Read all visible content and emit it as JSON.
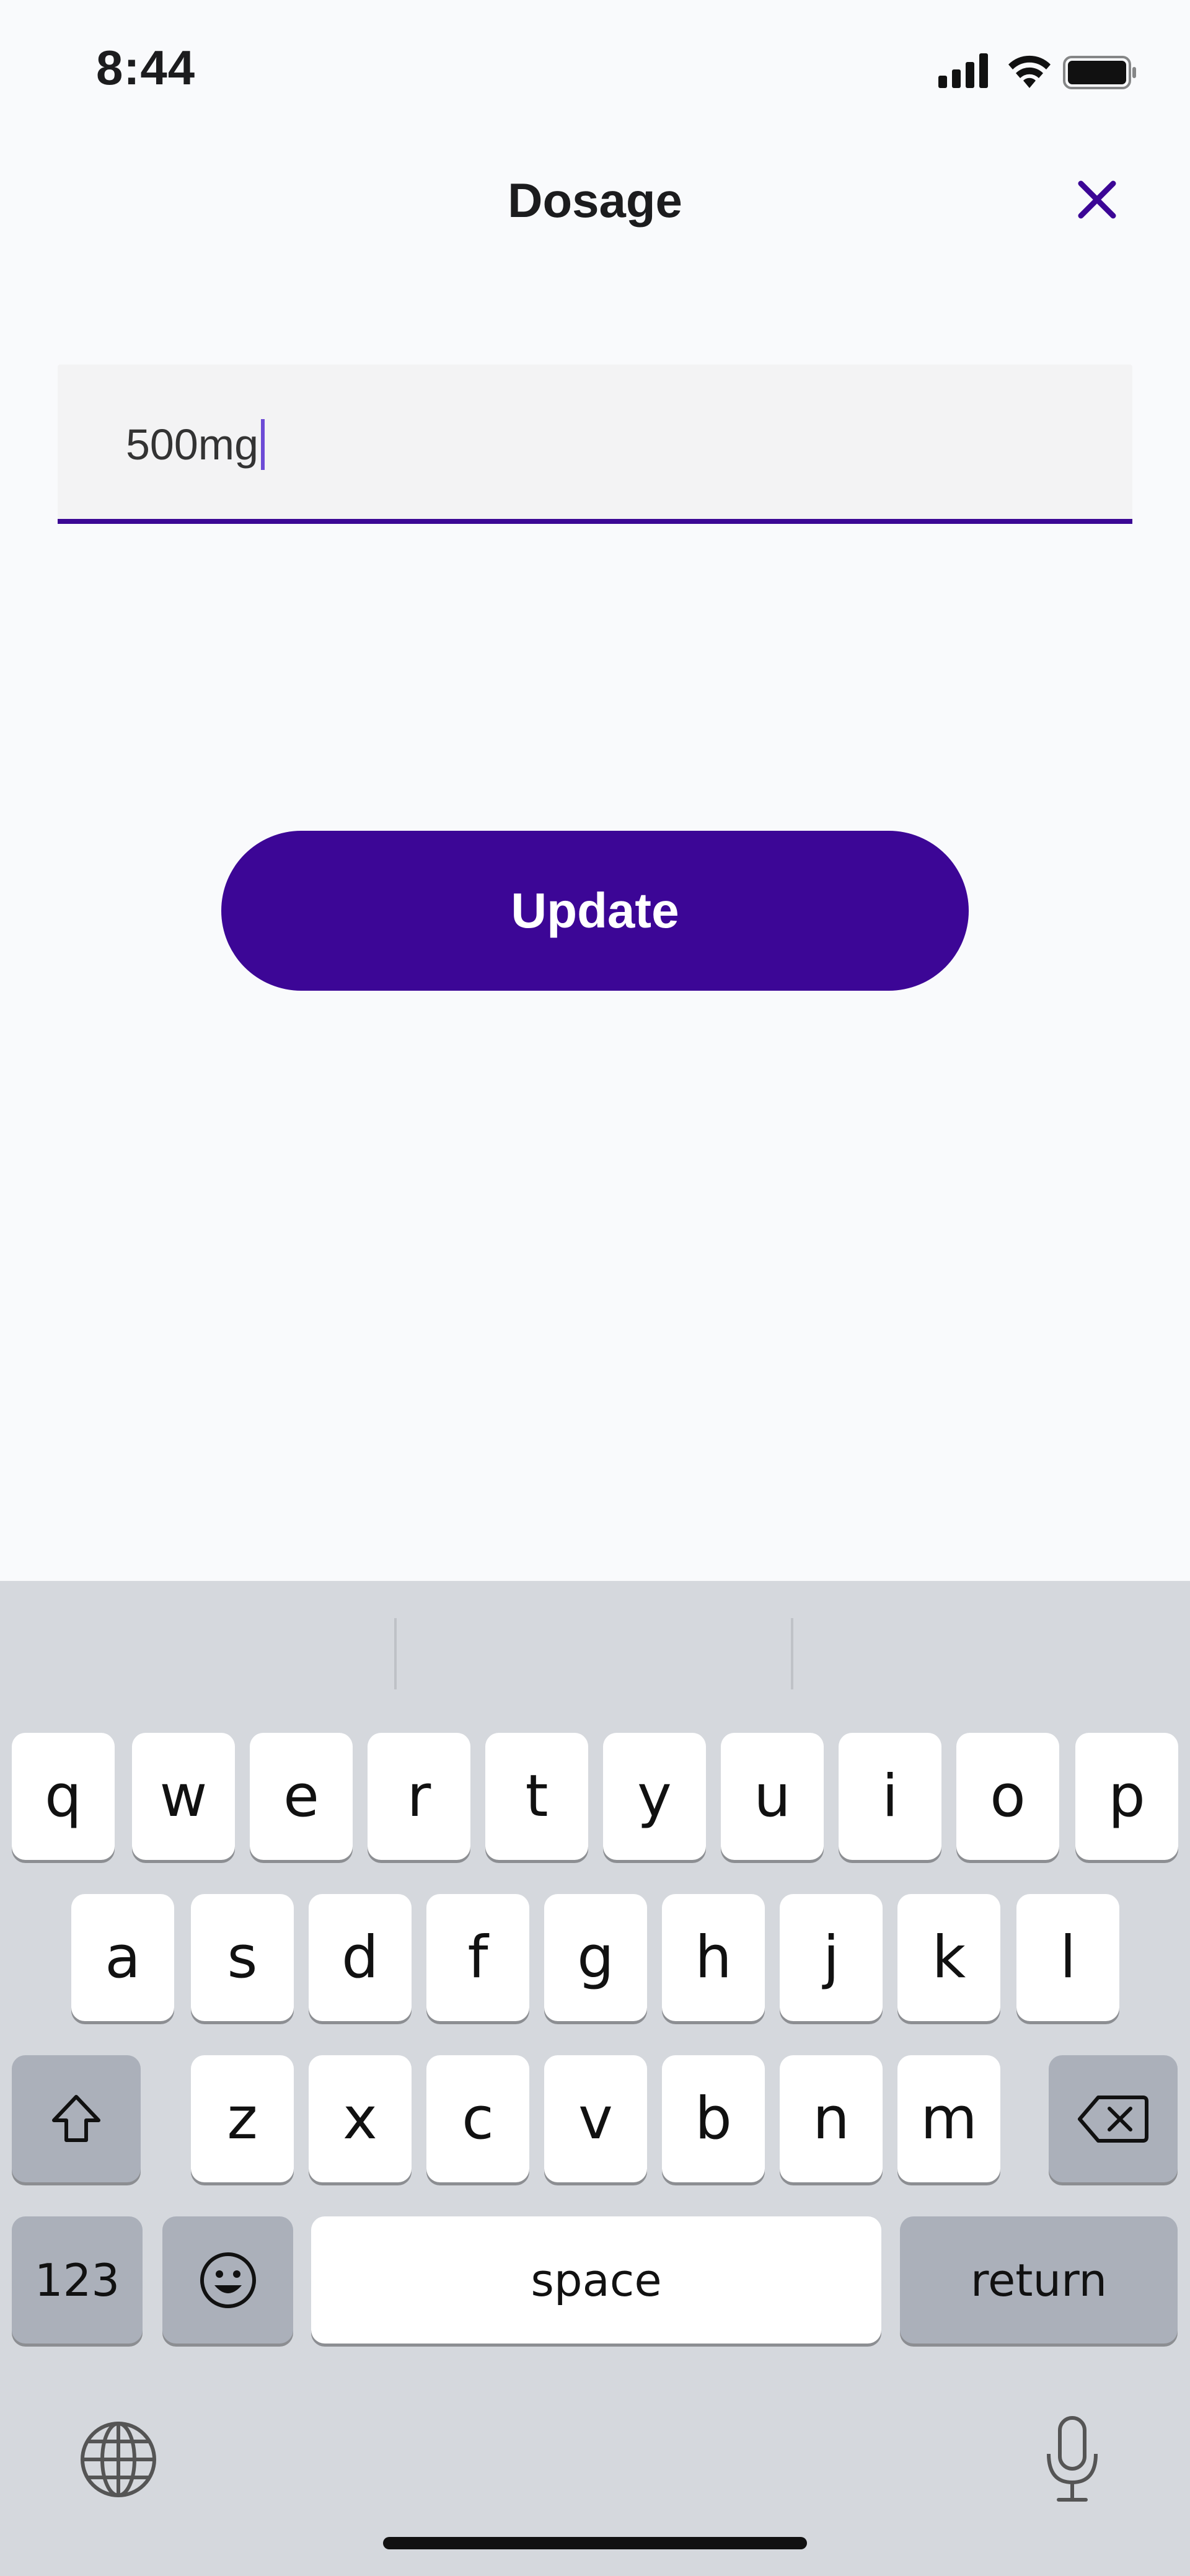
{
  "status_bar": {
    "time": "8:44"
  },
  "header": {
    "title": "Dosage"
  },
  "dosage_input": {
    "value": "500mg"
  },
  "actions": {
    "update_label": "Update"
  },
  "keyboard": {
    "row1": [
      "q",
      "w",
      "e",
      "r",
      "t",
      "y",
      "u",
      "i",
      "o",
      "p"
    ],
    "row2": [
      "a",
      "s",
      "d",
      "f",
      "g",
      "h",
      "j",
      "k",
      "l"
    ],
    "row3": [
      "z",
      "x",
      "c",
      "v",
      "b",
      "n",
      "m"
    ],
    "numbers_label": "123",
    "space_label": "space",
    "return_label": "return"
  },
  "colors": {
    "accent": "#3c0696",
    "background": "#f9fafc",
    "keyboard_bg": "#d5d8dd"
  },
  "icons": [
    "signal-icon",
    "wifi-icon",
    "battery-icon",
    "close-icon",
    "shift-icon",
    "backspace-icon",
    "emoji-icon",
    "globe-icon",
    "microphone-icon"
  ]
}
